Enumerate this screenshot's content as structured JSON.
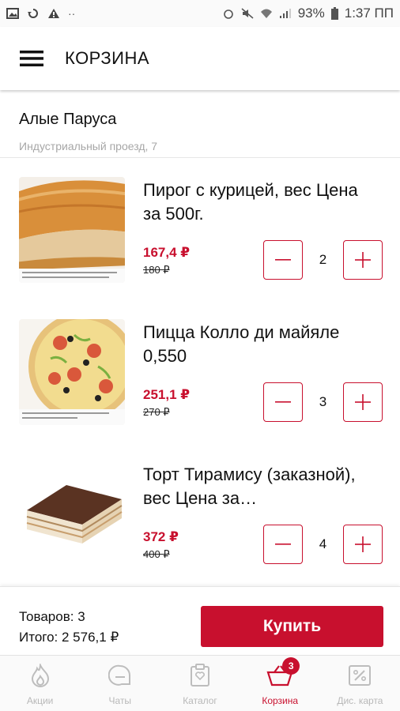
{
  "status_bar": {
    "battery": "93%",
    "time": "1:37 ПП"
  },
  "app_bar": {
    "title": "КОРЗИНА"
  },
  "store": {
    "name": "Алые Паруса",
    "address": "Индустриальный проезд, 7"
  },
  "items": [
    {
      "name": "Пирог с курицей, вес Цена за 500г.",
      "price": "167,4 ₽",
      "old_price": "180 ₽",
      "quantity": "2"
    },
    {
      "name": "Пицца Колло ди майяле 0,550",
      "price": "251,1 ₽",
      "old_price": "270 ₽",
      "quantity": "3"
    },
    {
      "name": "Торт Тирамису (заказной), вес Цена за…",
      "price": "372 ₽",
      "old_price": "400 ₽",
      "quantity": "4"
    }
  ],
  "summary": {
    "count_text": "Товаров: 3",
    "total_text": "Итого: 2 576,1 ₽",
    "buy_label": "Купить"
  },
  "bottom_nav": {
    "items": [
      {
        "label": "Акции",
        "icon": "flame-icon"
      },
      {
        "label": "Чаты",
        "icon": "chat-icon"
      },
      {
        "label": "Каталог",
        "icon": "catalog-icon"
      },
      {
        "label": "Корзина",
        "icon": "basket-icon",
        "badge": "3"
      },
      {
        "label": "Дис. карта",
        "icon": "discount-card-icon"
      }
    ]
  },
  "colors": {
    "accent": "#c8102e",
    "inactive": "#b8b8b8"
  }
}
